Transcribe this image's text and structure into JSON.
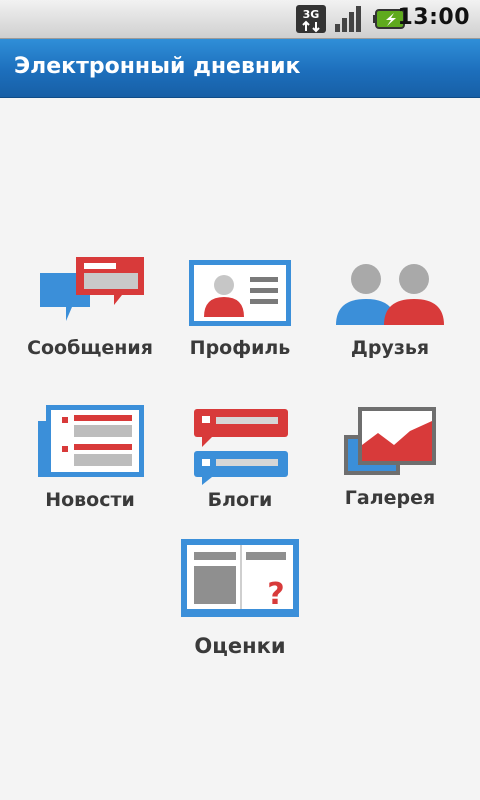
{
  "status_bar": {
    "network_icon": "3g-data-icon",
    "signal_icon": "signal-strength-icon",
    "battery_icon": "battery-charging-icon",
    "network_label": "3G",
    "time": "13:00"
  },
  "app": {
    "title": "Электронный дневник"
  },
  "menu": {
    "items": [
      {
        "label": "Сообщения",
        "icon": "messages-icon"
      },
      {
        "label": "Профиль",
        "icon": "profile-card-icon"
      },
      {
        "label": "Друзья",
        "icon": "friends-icon"
      },
      {
        "label": "Новости",
        "icon": "news-icon"
      },
      {
        "label": "Блоги",
        "icon": "blogs-icon"
      },
      {
        "label": "Галерея",
        "icon": "gallery-icon"
      },
      {
        "label": "Оценки",
        "icon": "grades-book-icon"
      }
    ]
  },
  "colors": {
    "title_bar": "#1d6fbc",
    "accent_red": "#d83a3a",
    "accent_blue": "#3b8fd9",
    "label_text": "#3a3a3a"
  }
}
